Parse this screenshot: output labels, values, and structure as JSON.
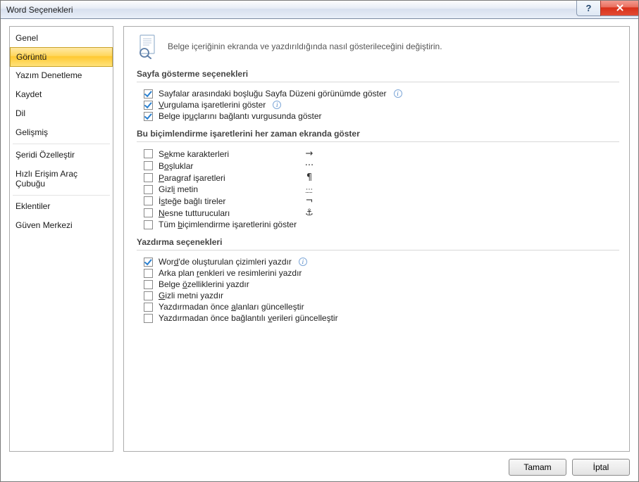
{
  "window": {
    "title": "Word Seçenekleri"
  },
  "sidebar": {
    "items": [
      {
        "label": "Genel"
      },
      {
        "label": "Görüntü",
        "selected": true
      },
      {
        "label": "Yazım Denetleme"
      },
      {
        "label": "Kaydet"
      },
      {
        "label": "Dil"
      },
      {
        "label": "Gelişmiş"
      },
      {
        "label": "Şeridi Özelleştir",
        "sepBefore": true
      },
      {
        "label": "Hızlı Erişim Araç Çubuğu"
      },
      {
        "label": "Eklentiler",
        "sepBefore": true
      },
      {
        "label": "Güven Merkezi"
      }
    ]
  },
  "header": {
    "text": "Belge içeriğinin ekranda ve yazdırıldığında nasıl gösterileceğini değiştirin."
  },
  "sections": {
    "pageDisplay": {
      "title": "Sayfa gösterme seçenekleri",
      "opts": [
        {
          "html": "Sayfalar arasındaki boşluğu Sayfa Düzeni görünümde <u>g</u>öster",
          "checked": true,
          "info": true
        },
        {
          "html": "<u>V</u>urgulama işaretlerini göster",
          "checked": true,
          "info": true
        },
        {
          "html": "Belge ip<u>u</u>çlarını bağlantı vurgusunda göster",
          "checked": true
        }
      ]
    },
    "formatting": {
      "title": "Bu biçimlendirme işaretlerini her zaman ekranda göster",
      "opts": [
        {
          "html": "S<u>e</u>kme karakterleri",
          "sym": "→",
          "checked": false
        },
        {
          "html": "B<u>o</u>şluklar",
          "sym": "···",
          "checked": false
        },
        {
          "html": "<u>P</u>aragraf işaretleri",
          "sym": "¶",
          "checked": false
        },
        {
          "html": "Gizl<u>i</u> metin",
          "sym": "⋯",
          "symStyle": "text-decoration: underline dotted; font-size:10px;",
          "checked": false
        },
        {
          "html": "İ<u>s</u>teğe bağlı tireler",
          "sym": "¬",
          "checked": false
        },
        {
          "html": "<u>N</u>esne tutturucuları",
          "sym": "⚓",
          "checked": false
        },
        {
          "html": "Tüm <u>b</u>içimlendirme işaretlerini göster",
          "checked": false
        }
      ]
    },
    "printing": {
      "title": "Yazdırma seçenekleri",
      "opts": [
        {
          "html": "Wor<u>d</u>'de oluşturulan çizimleri yazdır",
          "checked": true,
          "info": true
        },
        {
          "html": "Arka plan <u>r</u>enkleri ve resimlerini yazdır",
          "checked": false
        },
        {
          "html": "Belge <u>ö</u>zelliklerini yazdır",
          "checked": false
        },
        {
          "html": "<u>G</u>izli metni yazdır",
          "checked": false
        },
        {
          "html": "Yazdırmadan önce <u>a</u>lanları güncelleştir",
          "checked": false
        },
        {
          "html": "Yazdırmadan önce bağlantılı <u>v</u>erileri güncelleştir",
          "checked": false
        }
      ]
    }
  },
  "footer": {
    "ok": "Tamam",
    "cancel": "İptal"
  }
}
